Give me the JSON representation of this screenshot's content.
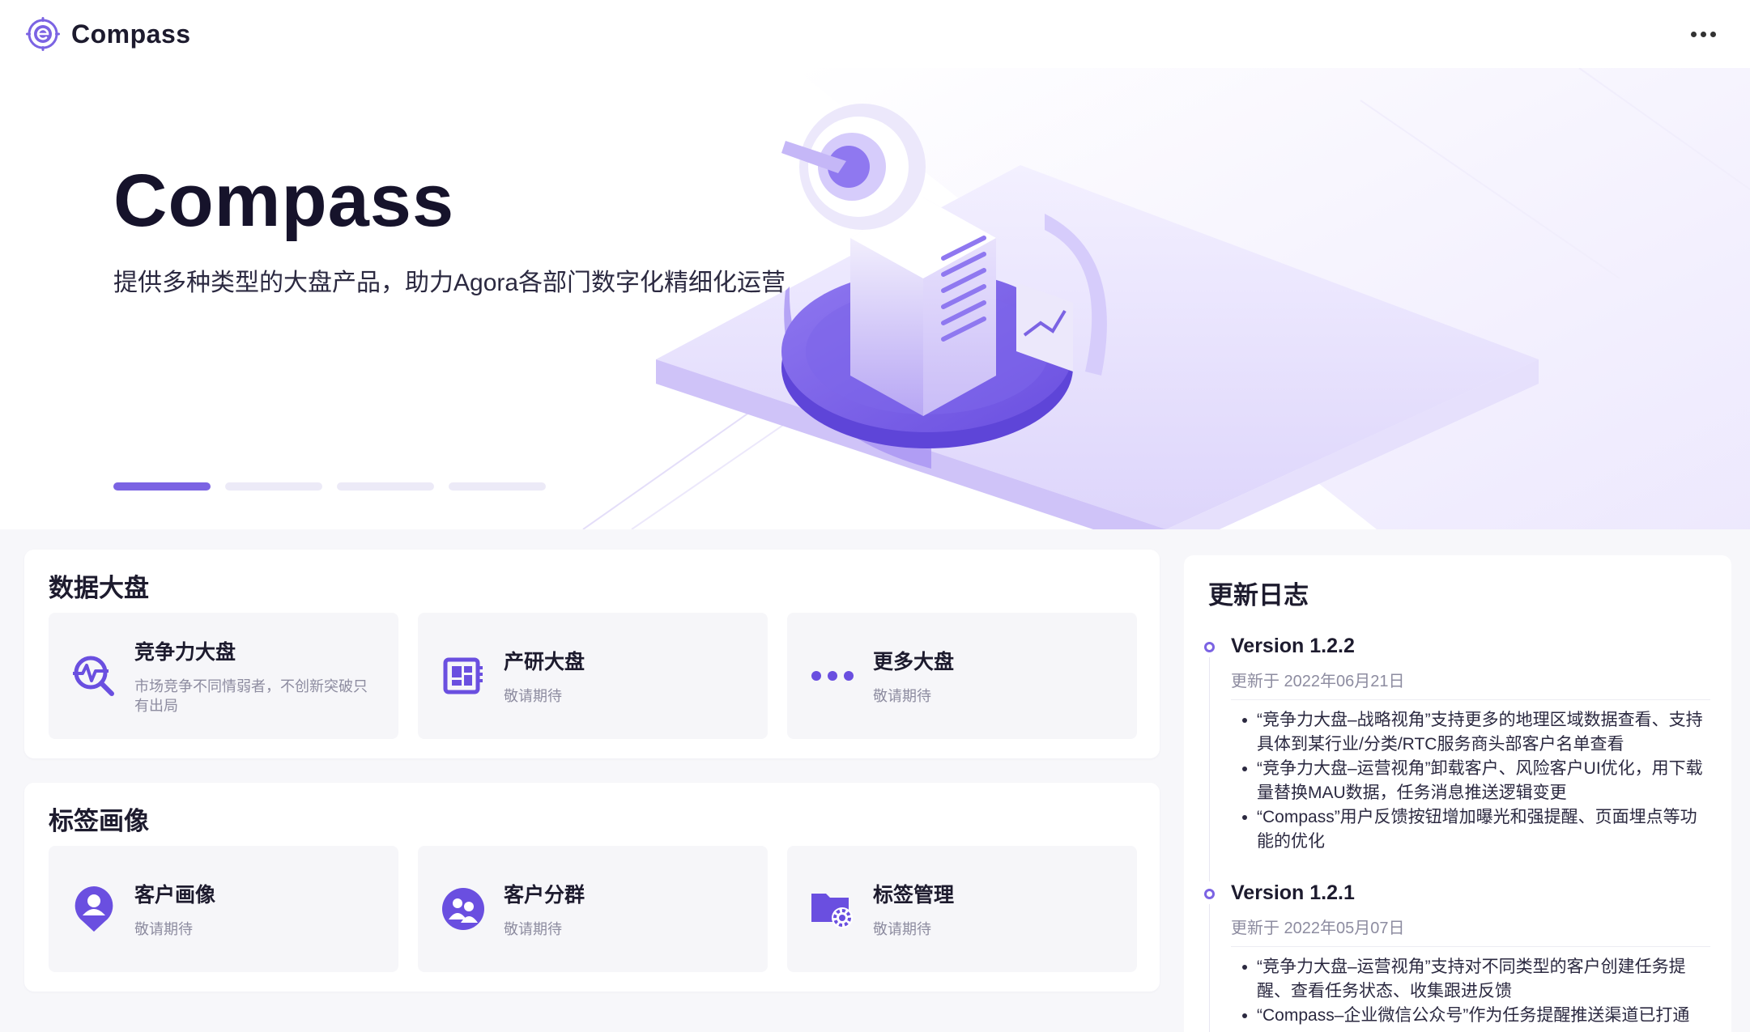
{
  "brand": {
    "name": "Compass"
  },
  "hero": {
    "title": "Compass",
    "subtitle": "提供多种类型的大盘产品，助力Agora各部门数字化精细化运营",
    "slides_total": 4,
    "active_slide": 1
  },
  "dashboards": {
    "title": "数据大盘",
    "cards": [
      {
        "title": "竞争力大盘",
        "desc": "市场竞争不同情弱者，不创新突破只有出局",
        "icon": "pulse-search-icon"
      },
      {
        "title": "产研大盘",
        "desc": "敬请期待",
        "icon": "dashboard-grid-icon"
      },
      {
        "title": "更多大盘",
        "desc": "敬请期待",
        "icon": "more-dots-icon"
      }
    ]
  },
  "tags": {
    "title": "标签画像",
    "cards": [
      {
        "title": "客户画像",
        "desc": "敬请期待",
        "icon": "user-pin-icon"
      },
      {
        "title": "客户分群",
        "desc": "敬请期待",
        "icon": "user-group-icon"
      },
      {
        "title": "标签管理",
        "desc": "敬请期待",
        "icon": "folder-gear-icon"
      }
    ]
  },
  "changelog": {
    "title": "更新日志",
    "versions": [
      {
        "name": "Version 1.2.2",
        "date": "更新于 2022年06月21日",
        "items": [
          "“竞争力大盘–战略视角”支持更多的地理区域数据查看、支持具体到某行业/分类/RTC服务商头部客户名单查看",
          "“竞争力大盘–运营视角”卸载客户、风险客户UI优化，用下载量替换MAU数据，任务消息推送逻辑变更",
          "“Compass”用户反馈按钮增加曝光和强提醒、页面埋点等功能的优化"
        ]
      },
      {
        "name": "Version 1.2.1",
        "date": "更新于 2022年05月07日",
        "items": [
          "“竞争力大盘–运营视角”支持对不同类型的客户创建任务提醒、查看任务状态、收集跟进反馈",
          "“Compass–企业微信公众号”作为任务提醒推送渠道已打通"
        ]
      }
    ]
  },
  "colors": {
    "accent": "#7b63e3",
    "accent_light": "#ece8fb",
    "text": "#1d1b2e",
    "muted": "#8d8ca0"
  }
}
